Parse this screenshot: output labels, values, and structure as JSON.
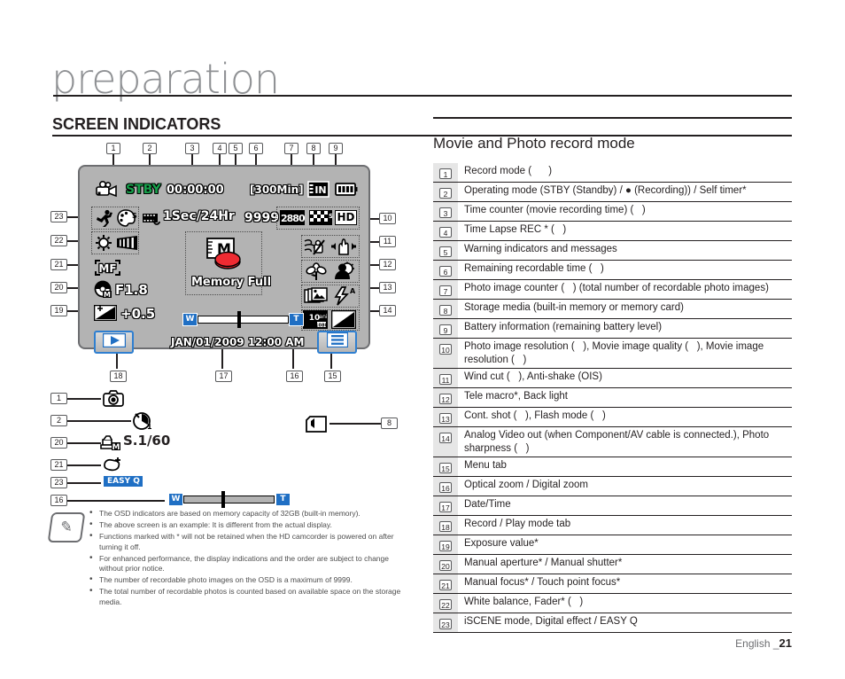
{
  "header": {
    "chapter": "preparation",
    "section": "SCREEN INDICATORS"
  },
  "lcd": {
    "mode_icon": "movie-camera-icon",
    "operating_mode": "STBY",
    "time_counter": "00:00:00",
    "remaining_time": "[300Min]",
    "storage_media": "IN",
    "battery": "battery-full-icon",
    "iscene_icon": "sports-iscene-icon",
    "digital_effect_icon": "palette-digital-effect-icon",
    "time_lapse_icon": "timelapse-film-icon",
    "time_lapse_value": "1Sec/24Hr",
    "photo_counter": "9999",
    "photo_resolution": "2880",
    "movie_quality_icon": "checkerboard-quality-icon",
    "movie_resolution": "HD",
    "white_balance_icon": "sun-white-balance-icon",
    "fader_icon": "fader-gradient-icon",
    "manual_focus": "MF",
    "aperture_icon": "manual-aperture-icon",
    "aperture_value": "F1.8",
    "exposure_icon": "exposure-icon",
    "exposure_value": "+0.5",
    "warning_message": "Memory Full",
    "warning_icon": "memory-full-icon",
    "wind_cut_icon": "wind-cut-icon",
    "anti_shake_icon": "anti-shake-ois-icon",
    "tele_macro_icon": "tele-macro-flower-icon",
    "back_light_icon": "back-light-icon",
    "cont_shot_icon": "continuous-shot-icon",
    "flash_icon": "flash-auto-icon",
    "analog_out_icon": "analog-video-out-icon",
    "sharpness_icon": "photo-sharpness-icon",
    "zoom_w": "W",
    "zoom_t": "T",
    "date_time": "JAN/01/2009 12:00 AM",
    "play_tab_icon": "play-mode-tab-icon",
    "menu_tab_icon": "menu-tab-icon"
  },
  "callouts": {
    "top": [
      "1",
      "2",
      "3",
      "4",
      "5",
      "6",
      "7",
      "8",
      "9"
    ],
    "left": [
      "23",
      "22",
      "21",
      "20",
      "19"
    ],
    "right": [
      "10",
      "11",
      "12",
      "13",
      "14"
    ],
    "bottom": [
      "18",
      "17",
      "16",
      "15"
    ]
  },
  "extra_icons": {
    "rows": [
      {
        "num": "1",
        "icon": "photo-camera-icon",
        "label": ""
      },
      {
        "num": "2",
        "icon": "self-timer-icon",
        "label": ""
      },
      {
        "num": "20",
        "icon": "manual-shutter-icon",
        "label": "S.1/60"
      },
      {
        "num": "21",
        "icon": "touch-point-focus-icon",
        "label": ""
      },
      {
        "num": "23",
        "icon": "easy-q-icon",
        "label": "EASY Q"
      },
      {
        "num": "16",
        "icon": "digital-zoom-bar-icon",
        "label": ""
      }
    ],
    "card": {
      "num": "8",
      "icon": "memory-card-icon"
    }
  },
  "notes": [
    "The OSD indicators are based on memory capacity of 32GB (built-in memory).",
    "The above screen is an example: It is different from the actual display.",
    "Functions marked with * will not be retained when the HD camcorder is powered on after turning it off.",
    "For enhanced performance, the display indications and the order are subject to change without prior notice.",
    "The number of recordable photo images on the OSD is a maximum of 9999.",
    "The total number of recordable photos is counted based on available space on the storage media."
  ],
  "right_panel": {
    "title": "Movie and Photo record mode",
    "items": [
      {
        "num": "1",
        "text": "Record mode (      )"
      },
      {
        "num": "2",
        "text": "Operating mode (STBY (Standby) / ● (Recording)) / Self timer*"
      },
      {
        "num": "3",
        "text": "Time counter (movie recording time) (   )"
      },
      {
        "num": "4",
        "text": "Time Lapse REC * (   )"
      },
      {
        "num": "5",
        "text": "Warning indicators and messages"
      },
      {
        "num": "6",
        "text": "Remaining recordable time (   )"
      },
      {
        "num": "7",
        "text": "Photo image counter (   ) (total number of recordable photo images)"
      },
      {
        "num": "8",
        "text": "Storage media (built-in memory or memory card)"
      },
      {
        "num": "9",
        "text": "Battery information (remaining battery level)"
      },
      {
        "num": "10",
        "text": "Photo image resolution (   ), Movie image quality (   ), Movie image resolution (   )"
      },
      {
        "num": "11",
        "text": "Wind cut (   ), Anti-shake (OIS)"
      },
      {
        "num": "12",
        "text": "Tele macro*, Back light"
      },
      {
        "num": "13",
        "text": "Cont. shot (   ), Flash mode (   )"
      },
      {
        "num": "14",
        "text": "Analog Video out (when Component/AV cable is connected.), Photo sharpness (   )"
      },
      {
        "num": "15",
        "text": "Menu tab"
      },
      {
        "num": "16",
        "text": "Optical zoom / Digital zoom"
      },
      {
        "num": "17",
        "text": "Date/Time"
      },
      {
        "num": "18",
        "text": "Record / Play mode tab"
      },
      {
        "num": "19",
        "text": "Exposure value*"
      },
      {
        "num": "20",
        "text": "Manual aperture* / Manual shutter*"
      },
      {
        "num": "21",
        "text": "Manual focus* / Touch point focus*"
      },
      {
        "num": "22",
        "text": "White balance, Fader* (   )"
      },
      {
        "num": "23",
        "text": "iSCENE mode, Digital effect / EASY Q"
      }
    ]
  },
  "footer": {
    "language": "English _",
    "page": "21"
  },
  "colors": {
    "accent_blue": "#1f6fc4",
    "stby_green": "#16a04b",
    "lcd_bg": "#b3b3b3",
    "warning_red": "#d8232a",
    "text": "#231f20"
  }
}
